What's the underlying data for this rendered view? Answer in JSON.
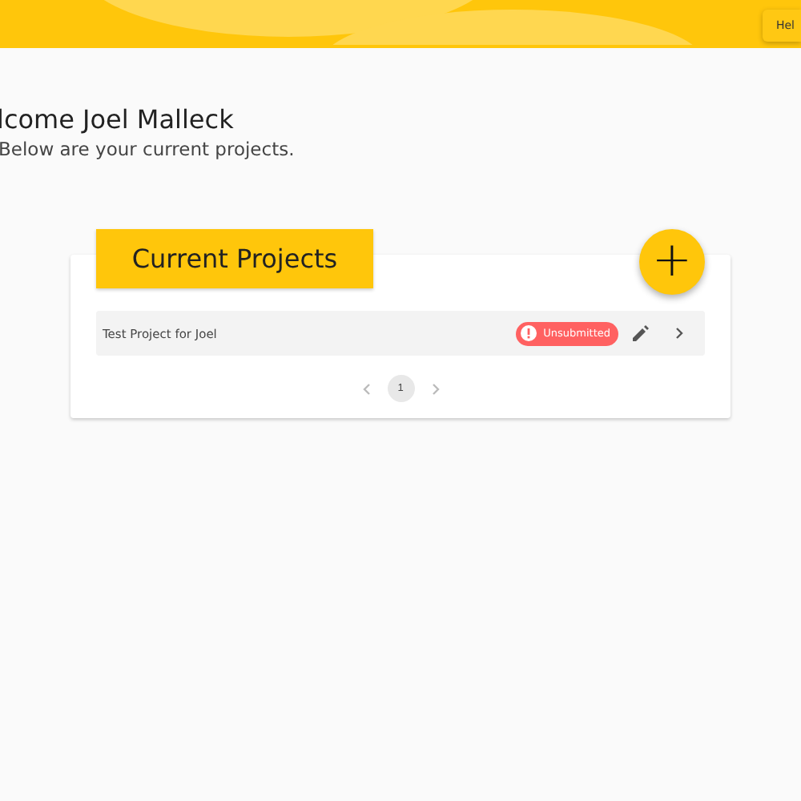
{
  "header": {
    "help_button": "Hel"
  },
  "welcome": {
    "title": "lcome Joel Malleck",
    "subtitle": "Below are your current projects."
  },
  "projects_card": {
    "title": "Current Projects",
    "add_button": "+",
    "rows": [
      {
        "name": "Test Project for Joel",
        "status": "Unsubmitted",
        "color": "#ff6161"
      }
    ],
    "pagination": {
      "prev_disabled": true,
      "next_disabled": true,
      "pages": [
        {
          "label": "1",
          "selected": true
        }
      ]
    }
  }
}
